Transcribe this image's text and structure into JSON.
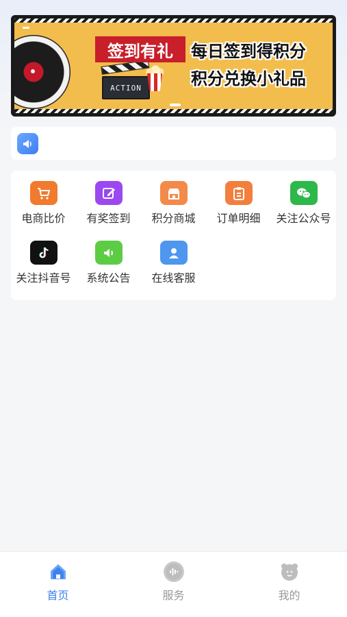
{
  "banner": {
    "tag": "签到有礼",
    "line1": "每日签到得积分",
    "line2": "积分兑换小礼品",
    "clapper_text": "ACTION"
  },
  "notice": {
    "icon": "megaphone-icon",
    "text": ""
  },
  "grid": [
    {
      "label": "电商比价",
      "icon": "cart-icon",
      "color": "#f07a2e"
    },
    {
      "label": "有奖签到",
      "icon": "edit-icon",
      "color": "#9b48f0"
    },
    {
      "label": "积分商城",
      "icon": "store-icon",
      "color": "#f38a4a"
    },
    {
      "label": "订单明细",
      "icon": "clipboard-icon",
      "color": "#f27f3e"
    },
    {
      "label": "关注公众号",
      "icon": "wechat-icon",
      "color": "#2db84a"
    },
    {
      "label": "关注抖音号",
      "icon": "tiktok-icon",
      "color": "#111111"
    },
    {
      "label": "系统公告",
      "icon": "speaker-icon",
      "color": "#5ccc45"
    },
    {
      "label": "在线客服",
      "icon": "person-icon",
      "color": "#4e96ee"
    }
  ],
  "tabs": [
    {
      "label": "首页",
      "icon": "home-icon",
      "active": true
    },
    {
      "label": "服务",
      "icon": "service-icon",
      "active": false
    },
    {
      "label": "我的",
      "icon": "profile-icon",
      "active": false
    }
  ],
  "colors": {
    "accent": "#3f82ee",
    "inactive": "#999999",
    "banner_bg": "#f3bd4d",
    "banner_tag": "#c81f2b"
  }
}
